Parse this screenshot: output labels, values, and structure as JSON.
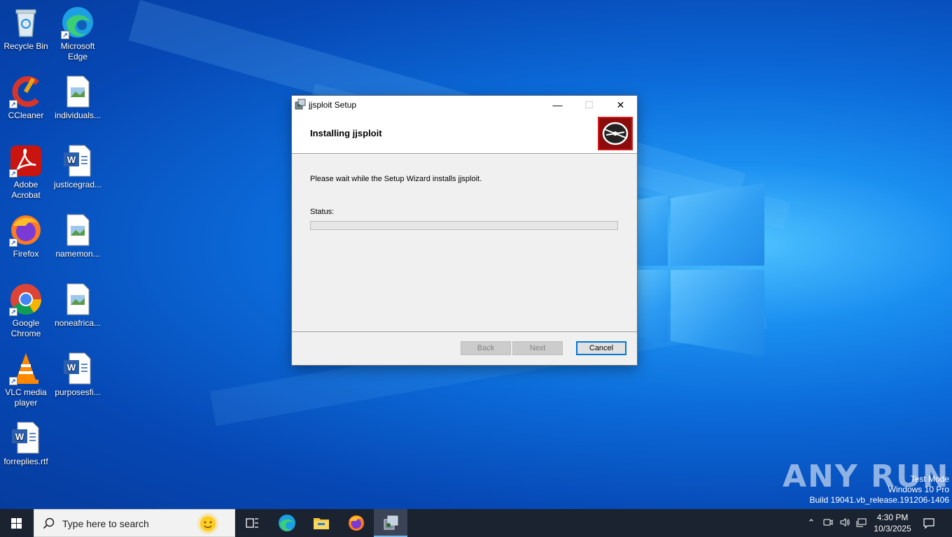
{
  "desktop": {
    "icons": [
      {
        "label": "Recycle Bin",
        "icon": "recycle-bin-icon"
      },
      {
        "label": "Microsoft Edge",
        "icon": "edge-icon"
      },
      {
        "label": "CCleaner",
        "icon": "ccleaner-icon"
      },
      {
        "label": "individuals...",
        "icon": "image-file-icon"
      },
      {
        "label": "Adobe Acrobat",
        "icon": "acrobat-icon"
      },
      {
        "label": "justicegrad...",
        "icon": "word-doc-icon"
      },
      {
        "label": "Firefox",
        "icon": "firefox-icon"
      },
      {
        "label": "namemon...",
        "icon": "image-file-icon"
      },
      {
        "label": "Google Chrome",
        "icon": "chrome-icon"
      },
      {
        "label": "noneafrica...",
        "icon": "image-file-icon"
      },
      {
        "label": "VLC media player",
        "icon": "vlc-icon"
      },
      {
        "label": "purposesfi...",
        "icon": "word-doc-icon"
      },
      {
        "label": "forreplies.rtf",
        "icon": "word-doc-icon"
      }
    ]
  },
  "dialog": {
    "title": "jjsploit Setup",
    "header_title": "Installing jjsploit",
    "body_text": "Please wait while the Setup Wizard installs jjsploit.",
    "status_label": "Status:",
    "progress_fraction": 0,
    "buttons": {
      "back": "Back",
      "next": "Next",
      "cancel": "Cancel"
    },
    "titlebar": {
      "minimize": "—",
      "maximize": "☐",
      "close": "✕"
    }
  },
  "watermark": {
    "brand": "ANY RUN",
    "line1": "Test Mode",
    "line2": "Windows 10 Pro",
    "line3": "Build 19041.vb_release.191206-1406"
  },
  "taskbar": {
    "search_placeholder": "Type here to search",
    "time": "4:30 PM",
    "date": "10/3/2025",
    "colors": {
      "taskbar": "#1b2330",
      "accent": "#0078d7"
    }
  }
}
